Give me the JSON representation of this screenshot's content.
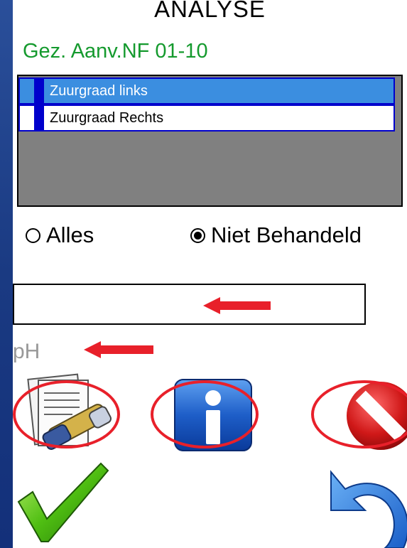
{
  "header": {
    "title": "ANALYSE",
    "subtitle": "Gez. Aanv.NF 01-10"
  },
  "list": {
    "items": [
      {
        "label": "Zuurgraad links",
        "selected": true
      },
      {
        "label": "Zuurgraad Rechts",
        "selected": false
      }
    ]
  },
  "filter": {
    "options": [
      {
        "label": "Alles",
        "checked": false
      },
      {
        "label": "Niet Behandeld",
        "checked": true
      }
    ]
  },
  "input": {
    "value": ""
  },
  "field_label": "pH",
  "toolbar": {
    "icons": [
      "edit-document-icon",
      "info-icon",
      "cancel-icon",
      "confirm-check-icon",
      "undo-icon"
    ]
  },
  "colors": {
    "title_green": "#159a2e",
    "selection_blue": "#3b8ee0",
    "marker_blue": "#0000cc",
    "annotation_red": "#e8202a",
    "slide_background": "#1d3a7a"
  }
}
